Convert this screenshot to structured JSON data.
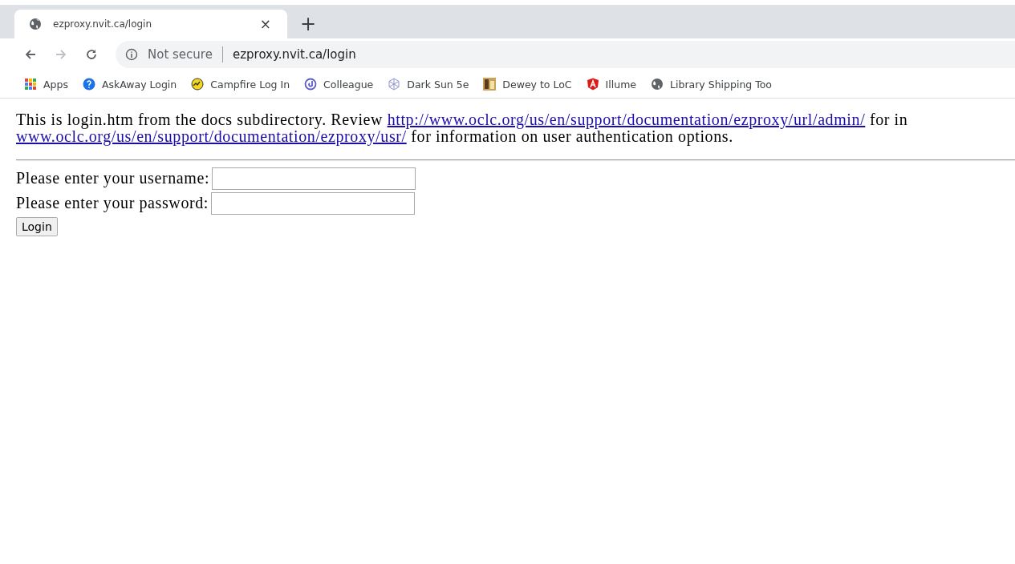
{
  "tab": {
    "title": "ezproxy.nvit.ca/login",
    "close": "×",
    "new_tab": "+",
    "selected": true
  },
  "address_bar": {
    "security": "Not secure",
    "url": "ezproxy.nvit.ca/login"
  },
  "bookmarks": [
    {
      "label": "Apps"
    },
    {
      "label": "AskAway Login"
    },
    {
      "label": "Campfire Log In"
    },
    {
      "label": "Colleague"
    },
    {
      "label": "Dark Sun 5e"
    },
    {
      "label": "Dewey to LoC"
    },
    {
      "label": "Illume"
    },
    {
      "label": "Library Shipping Too"
    }
  ],
  "intro": {
    "line_1": {
      "text": "This is login.htm from the docs subdirectory. Review ",
      "link": "http://www.oclc.org/us/en/support/documentation/ezproxy/url/admin/",
      "after": " for in"
    },
    "line_2": {
      "link": "www.oclc.org/us/en/support/documentation/ezproxy/usr/",
      "after": " for information on user authentication options."
    }
  },
  "form": {
    "fields": [
      {
        "label": "Please enter your username:"
      },
      {
        "label": "Please enter your password:"
      }
    ],
    "button": "Login"
  }
}
